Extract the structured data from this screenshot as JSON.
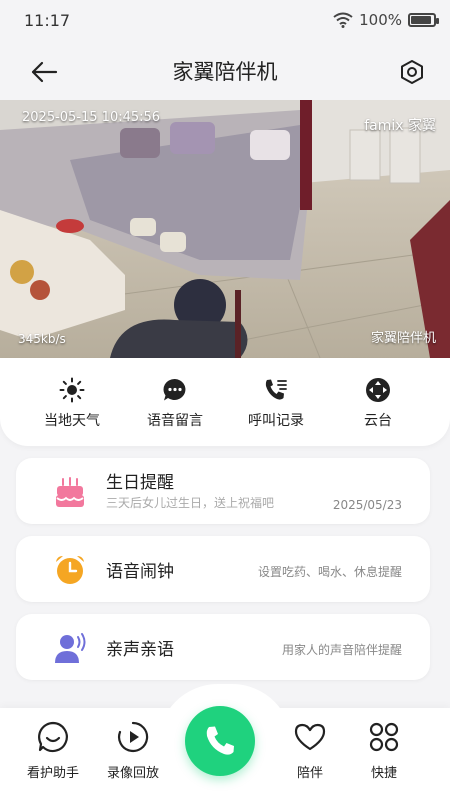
{
  "status": {
    "time": "11:17",
    "battery_text": "100%",
    "battery_level": 1.0,
    "icons": [
      "wifi-icon",
      "battery-icon"
    ]
  },
  "header": {
    "title": "家翼陪伴机",
    "back_icon": "arrow-left-icon",
    "settings_icon": "hexagon-settings-icon"
  },
  "video": {
    "timestamp": "2025-05-15  10:45:56",
    "brand": "famix 家翼",
    "bitrate": "345kb/s",
    "device_label": "家翼陪伴机"
  },
  "controls": [
    {
      "label": "当地天气",
      "icon": "sun-icon"
    },
    {
      "label": "语音留言",
      "icon": "chat-bubble-icon"
    },
    {
      "label": "呼叫记录",
      "icon": "phone-list-icon"
    },
    {
      "label": "云台",
      "icon": "directional-pad-icon"
    }
  ],
  "features": [
    {
      "title": "生日提醒",
      "subtitle": "三天后女儿过生日，送上祝福吧",
      "right": "2025/05/23",
      "icon": "cake-icon",
      "color": "#f2789d"
    },
    {
      "title": "语音闹钟",
      "subtitle": "",
      "right": "设置吃药、喝水、休息提醒",
      "icon": "alarm-clock-icon",
      "color": "#f5a623"
    },
    {
      "title": "亲声亲语",
      "subtitle": "",
      "right": "用家人的声音陪伴提醒",
      "icon": "person-voice-icon",
      "color": "#6f6fd9"
    }
  ],
  "nav": [
    {
      "label": "看护助手",
      "icon": "smile-face-icon"
    },
    {
      "label": "录像回放",
      "icon": "play-circle-icon"
    },
    {
      "label": "",
      "icon": "phone-call-icon"
    },
    {
      "label": "陪伴",
      "icon": "heart-icon"
    },
    {
      "label": "快捷",
      "icon": "grid-four-icon"
    }
  ],
  "colors": {
    "call_green": "#1fd27e",
    "accent_pink": "#f2789d",
    "accent_orange": "#f5a623",
    "accent_purple": "#6f6fd9"
  }
}
